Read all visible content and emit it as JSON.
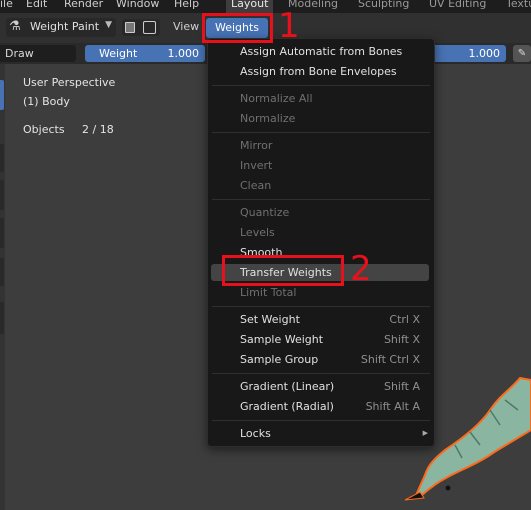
{
  "top_menu": {
    "items": [
      "ile",
      "Edit",
      "Render",
      "Window",
      "Help"
    ],
    "workspaces": [
      "Layout",
      "Modeling",
      "Sculpting",
      "UV Editing",
      "Texture"
    ],
    "active_workspace": "Layout"
  },
  "header": {
    "mode_label": "Weight Paint",
    "view_label": "View",
    "weights_label": "Weights"
  },
  "toolbar": {
    "brush_label": "Draw",
    "weight_label": "Weight",
    "weight_value": "1.000",
    "strength_value": "1.000"
  },
  "viewport": {
    "perspective": "User Perspective",
    "object": "(1) Body",
    "objects_label": "Objects",
    "objects_count": "2 / 18"
  },
  "weights_menu": {
    "groups": [
      [
        {
          "label": "Assign Automatic from Bones",
          "shortcut": "",
          "disabled": false
        },
        {
          "label": "Assign from Bone Envelopes",
          "shortcut": "",
          "disabled": false
        }
      ],
      [
        {
          "label": "Normalize All",
          "shortcut": "",
          "disabled": true
        },
        {
          "label": "Normalize",
          "shortcut": "",
          "disabled": true
        }
      ],
      [
        {
          "label": "Mirror",
          "shortcut": "",
          "disabled": true
        },
        {
          "label": "Invert",
          "shortcut": "",
          "disabled": true
        },
        {
          "label": "Clean",
          "shortcut": "",
          "disabled": true
        }
      ],
      [
        {
          "label": "Quantize",
          "shortcut": "",
          "disabled": true
        },
        {
          "label": "Levels",
          "shortcut": "",
          "disabled": true
        },
        {
          "label": "Smooth",
          "shortcut": "",
          "disabled": false
        },
        {
          "label": "Transfer Weights",
          "shortcut": "",
          "disabled": false,
          "highlighted": true
        },
        {
          "label": "Limit Total",
          "shortcut": "",
          "disabled": true
        }
      ],
      [
        {
          "label": "Set Weight",
          "shortcut": "Ctrl X",
          "disabled": false
        },
        {
          "label": "Sample Weight",
          "shortcut": "Shift X",
          "disabled": false
        },
        {
          "label": "Sample Group",
          "shortcut": "Shift Ctrl X",
          "disabled": false
        }
      ],
      [
        {
          "label": "Gradient (Linear)",
          "shortcut": "Shift A",
          "disabled": false
        },
        {
          "label": "Gradient (Radial)",
          "shortcut": "Shift Alt A",
          "disabled": false
        }
      ],
      [
        {
          "label": "Locks",
          "shortcut": "",
          "disabled": false,
          "submenu": true
        }
      ]
    ]
  },
  "annotations": {
    "step1": "1",
    "step2": "2"
  },
  "colors": {
    "accent": "#4772b3",
    "annotation": "#e8101a",
    "menu_bg": "#181818"
  }
}
